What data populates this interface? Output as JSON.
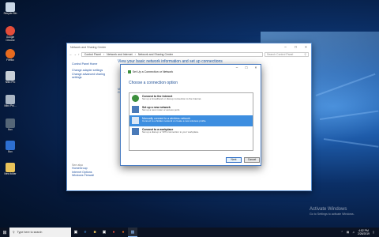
{
  "desktop": {
    "icons": [
      {
        "label": "Recycle Bin",
        "color": "#c9d7e6"
      },
      {
        "label": "Google Chrome",
        "color": "#e44d3a"
      },
      {
        "label": "Firefox",
        "color": "#e86b1f"
      },
      {
        "label": "Nitro Pro",
        "color": "#c8d0d8"
      },
      {
        "label": "Nitro Pro...",
        "color": "#aab6c4"
      },
      {
        "label": "Box",
        "color": "#556677"
      },
      {
        "label": "Box",
        "color": "#2d6fd1"
      },
      {
        "label": "New folder",
        "color": "#e9c35a"
      }
    ]
  },
  "window": {
    "title": "Network and Sharing Center",
    "address": [
      "Control Panel",
      "Network and Internet",
      "Network and Sharing Center"
    ],
    "search_placeholder": "Search Control Panel",
    "heading": "View your basic network information and set up connections",
    "left_links": [
      "Control Panel Home",
      "Change adapter settings",
      "Change advanced sharing settings"
    ],
    "see_also_title": "See also",
    "see_also": [
      "HomeGroup",
      "Internet Options",
      "Windows Firewall"
    ],
    "frag1": "Vi",
    "frag2": "Ch"
  },
  "dialog": {
    "breadcrumb": "Set Up a Connection or Network",
    "heading": "Choose a connection option",
    "options": [
      {
        "title": "Connect to the Internet",
        "desc": "Set up a broadband or dial-up connection to the Internet.",
        "icon_color": "#3c8f3c"
      },
      {
        "title": "Set up a new network",
        "desc": "Set up a new router or access point.",
        "icon_color": "#4a7ab8"
      },
      {
        "title": "Manually connect to a wireless network",
        "desc": "Connect to a hidden network or create a new wireless profile.",
        "icon_color": "#2a6fb8"
      },
      {
        "title": "Connect to a workplace",
        "desc": "Set up a dial-up or VPN connection to your workplace.",
        "icon_color": "#4a7ab8"
      }
    ],
    "selected_index": 2,
    "next_label": "Next",
    "cancel_label": "Cancel"
  },
  "watermark": {
    "line1": "Activate Windows",
    "line2": "Go to Settings to activate Windows."
  },
  "taskbar": {
    "search_text": "Type here to search",
    "time": "4:52 PM",
    "date": "2/26/2019"
  }
}
